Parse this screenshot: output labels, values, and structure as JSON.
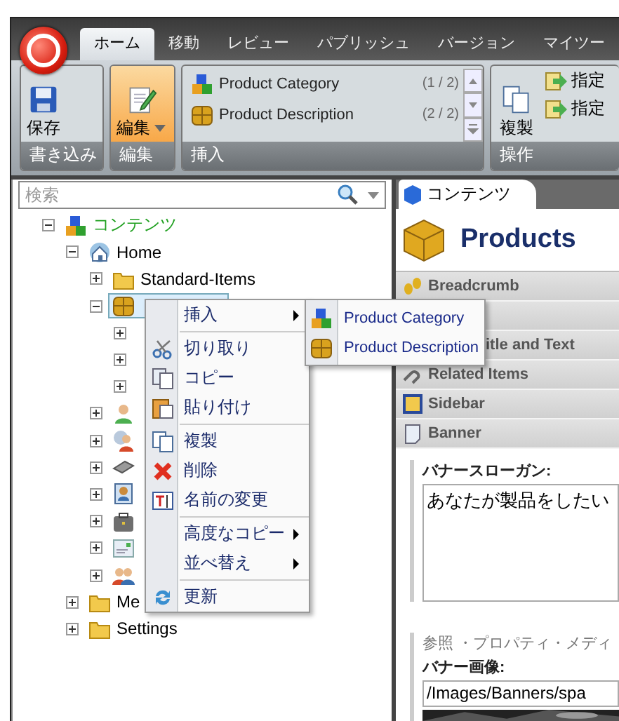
{
  "ribbon": {
    "tabs": [
      {
        "label": "ホーム",
        "selected": true
      },
      {
        "label": "移動",
        "selected": false
      },
      {
        "label": "レビュー",
        "selected": false
      },
      {
        "label": "パブリッシュ",
        "selected": false
      },
      {
        "label": "バージョン",
        "selected": false
      },
      {
        "label": "マイツー",
        "selected": false
      }
    ],
    "save": {
      "button": "保存",
      "group": "書き込み"
    },
    "edit": {
      "button": "編集",
      "group": "編集"
    },
    "insert": {
      "group": "挿入",
      "items": [
        {
          "label": "Product Category",
          "count": "(1 / 2)",
          "kind": "category"
        },
        {
          "label": "Product Description",
          "count": "(2 / 2)",
          "kind": "box"
        }
      ]
    },
    "operations": {
      "group": "操作",
      "duplicate": "複製",
      "items": [
        "指定",
        "指定"
      ]
    }
  },
  "search": {
    "placeholder": "検索"
  },
  "tree": [
    {
      "label": "コンテンツ",
      "kind": "category",
      "expanded": true,
      "selected": false,
      "children": [
        {
          "label": "Home",
          "kind": "home",
          "expanded": true,
          "selected": false,
          "children": [
            {
              "label": "Standard-Items",
              "kind": "folder",
              "expanded": false,
              "selected": false
            },
            {
              "kind": "box",
              "expanded": true,
              "selected": true,
              "children": [
                {
                  "expanded": false
                },
                {
                  "expanded": false
                },
                {
                  "expanded": false
                }
              ]
            },
            {
              "kind": "user",
              "expanded": false,
              "selected": false
            },
            {
              "kind": "globe-user",
              "expanded": false,
              "selected": false
            },
            {
              "kind": "device",
              "expanded": false,
              "selected": false
            },
            {
              "kind": "portrait",
              "expanded": false,
              "selected": false
            },
            {
              "kind": "briefcase",
              "expanded": false,
              "selected": false
            },
            {
              "kind": "card",
              "expanded": false,
              "selected": false
            },
            {
              "kind": "users",
              "expanded": false,
              "selected": false
            }
          ]
        },
        {
          "label": "Me",
          "kind": "folder",
          "expanded": false,
          "selected": false
        },
        {
          "label": "Settings",
          "kind": "folder",
          "expanded": false,
          "selected": false
        }
      ]
    }
  ],
  "context_menu": [
    {
      "kind": "submenu",
      "label": "挿入"
    },
    {
      "kind": "separator"
    },
    {
      "kind": "item",
      "label": "切り取り"
    },
    {
      "kind": "item",
      "label": "コピー"
    },
    {
      "kind": "item",
      "label": "貼り付け"
    },
    {
      "kind": "separator"
    },
    {
      "kind": "item",
      "label": "複製"
    },
    {
      "kind": "item",
      "label": "削除"
    },
    {
      "kind": "item",
      "label": "名前の変更"
    },
    {
      "kind": "separator"
    },
    {
      "kind": "submenu",
      "label": "高度なコピー"
    },
    {
      "kind": "submenu",
      "label": "並べ替え"
    },
    {
      "kind": "separator"
    },
    {
      "kind": "item",
      "label": "更新"
    }
  ],
  "submenu": [
    {
      "label": "Product Category",
      "kind": "category"
    },
    {
      "label": "Product Description",
      "kind": "box"
    }
  ],
  "editor": {
    "tab": "コンテンツ",
    "title": "Products",
    "sections": [
      {
        "label": "Breadcrumb",
        "kind": "steps"
      },
      {
        "kind": "blank"
      },
      {
        "label": "itle and Text",
        "kind": "covered"
      },
      {
        "label": "Related Items",
        "kind": "link"
      },
      {
        "label": "Sidebar",
        "kind": "frame"
      },
      {
        "label": "Banner",
        "kind": "banner"
      }
    ],
    "slogan_label": "バナースローガン:",
    "slogan_value": "あなたが製品をしたい",
    "links": "参照 ・プロパティ・メディ",
    "image_label": "バナー画像:",
    "image_value": "/Images/Banners/spa"
  }
}
